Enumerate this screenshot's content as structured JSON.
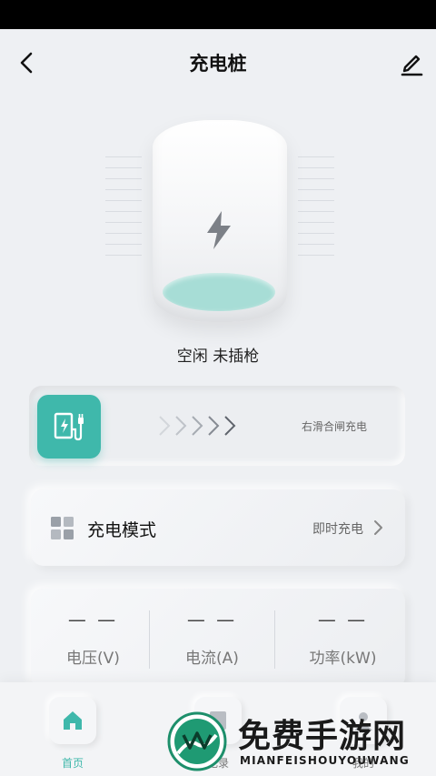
{
  "header": {
    "title": "充电桩"
  },
  "device": {
    "status": "空闲 未插枪",
    "fill_level_percent": 20,
    "liquid_color": "#a7ddd6"
  },
  "slider": {
    "hint": "右滑合闸充电",
    "accent": "#3fb8ab"
  },
  "mode": {
    "label": "充电模式",
    "value": "即时充电"
  },
  "stats": [
    {
      "value": "— —",
      "label": "电压(V)"
    },
    {
      "value": "— —",
      "label": "电流(A)"
    },
    {
      "value": "— —",
      "label": "功率(kW)"
    }
  ],
  "tabs": [
    {
      "label": "首页",
      "icon": "home-icon",
      "active": true
    },
    {
      "label": "记录",
      "icon": "record-icon",
      "active": false
    },
    {
      "label": "我的",
      "icon": "profile-icon",
      "active": false
    }
  ],
  "watermark": {
    "title": "免费手游网",
    "subtitle": "MIANFEISHOUYOUWANG"
  }
}
